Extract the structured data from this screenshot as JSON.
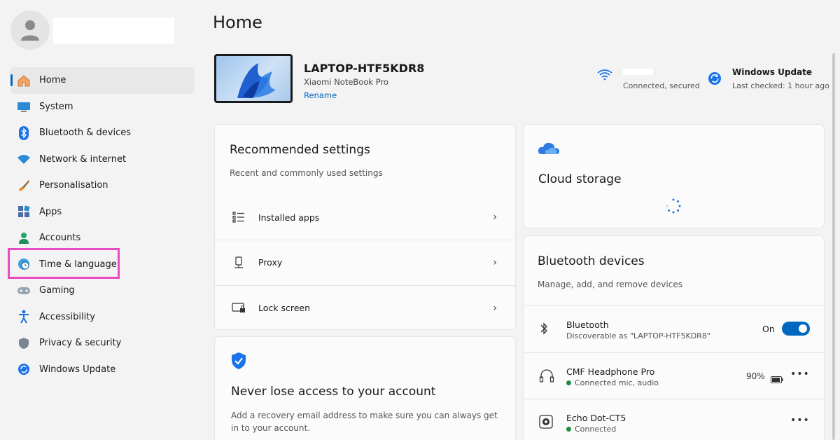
{
  "sidebar": {
    "items": [
      {
        "label": "Home",
        "icon": "home-icon"
      },
      {
        "label": "System",
        "icon": "system-icon"
      },
      {
        "label": "Bluetooth & devices",
        "icon": "bluetooth-icon"
      },
      {
        "label": "Network & internet",
        "icon": "wifi-icon"
      },
      {
        "label": "Personalisation",
        "icon": "brush-icon"
      },
      {
        "label": "Apps",
        "icon": "apps-icon"
      },
      {
        "label": "Accounts",
        "icon": "accounts-icon"
      },
      {
        "label": "Time & language",
        "icon": "globe-clock-icon"
      },
      {
        "label": "Gaming",
        "icon": "gamepad-icon"
      },
      {
        "label": "Accessibility",
        "icon": "accessibility-icon"
      },
      {
        "label": "Privacy & security",
        "icon": "shield-icon"
      },
      {
        "label": "Windows Update",
        "icon": "update-icon"
      }
    ],
    "active_index": 0,
    "highlighted_index": 7
  },
  "header": {
    "title": "Home"
  },
  "device": {
    "name": "LAPTOP-HTF5KDR8",
    "model": "Xiaomi NoteBook Pro",
    "rename_label": "Rename"
  },
  "status": {
    "wifi_status": "Connected, secured",
    "update_title": "Windows Update",
    "update_status": "Last checked: 1 hour ago"
  },
  "recommended": {
    "title": "Recommended settings",
    "subtitle": "Recent and commonly used settings",
    "rows": [
      {
        "label": "Installed apps",
        "icon": "list-icon"
      },
      {
        "label": "Proxy",
        "icon": "proxy-icon"
      },
      {
        "label": "Lock screen",
        "icon": "lock-screen-icon"
      }
    ]
  },
  "cloud": {
    "title": "Cloud storage"
  },
  "account_card": {
    "title": "Never lose access to your account",
    "description": "Add a recovery email address to make sure you can always get in to your account."
  },
  "bluetooth": {
    "title": "Bluetooth devices",
    "subtitle": "Manage, add, and remove devices",
    "toggle_row": {
      "title": "Bluetooth",
      "subtitle": "Discoverable as \"LAPTOP-HTF5KDR8\"",
      "state_label": "On",
      "enabled": true
    },
    "devices": [
      {
        "name": "CMF Headphone Pro",
        "status": "Connected mic, audio",
        "battery": "90%"
      },
      {
        "name": "Echo Dot-CT5",
        "status": "Connected"
      }
    ]
  },
  "colors": {
    "accent": "#0067c0",
    "highlight": "#e84cc4"
  }
}
